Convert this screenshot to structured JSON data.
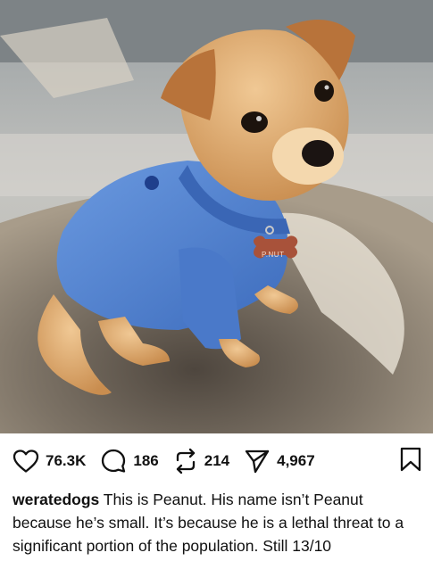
{
  "post": {
    "image_alt": "Small tan puppy wearing a blue sweatshirt with a bone-shaped name tag reading P.NUT, sitting on a sheepskin rug",
    "tag_text": "P.NUT",
    "likes": "76.3K",
    "comments": "186",
    "reposts": "214",
    "shares": "4,967",
    "username": "weratedogs",
    "caption": "This is Peanut. His name isn’t Peanut because he’s small. It’s because he is a lethal threat to a significant portion of the population. Still 13/10"
  },
  "icons": {
    "like": "heart-icon",
    "comment": "comment-bubble-icon",
    "repost": "repost-icon",
    "share": "send-icon",
    "save": "bookmark-icon"
  },
  "colors": {
    "sweater": "#4d7fd1",
    "fur": "#d6a063",
    "tag": "#a8523a",
    "text": "#111111"
  }
}
